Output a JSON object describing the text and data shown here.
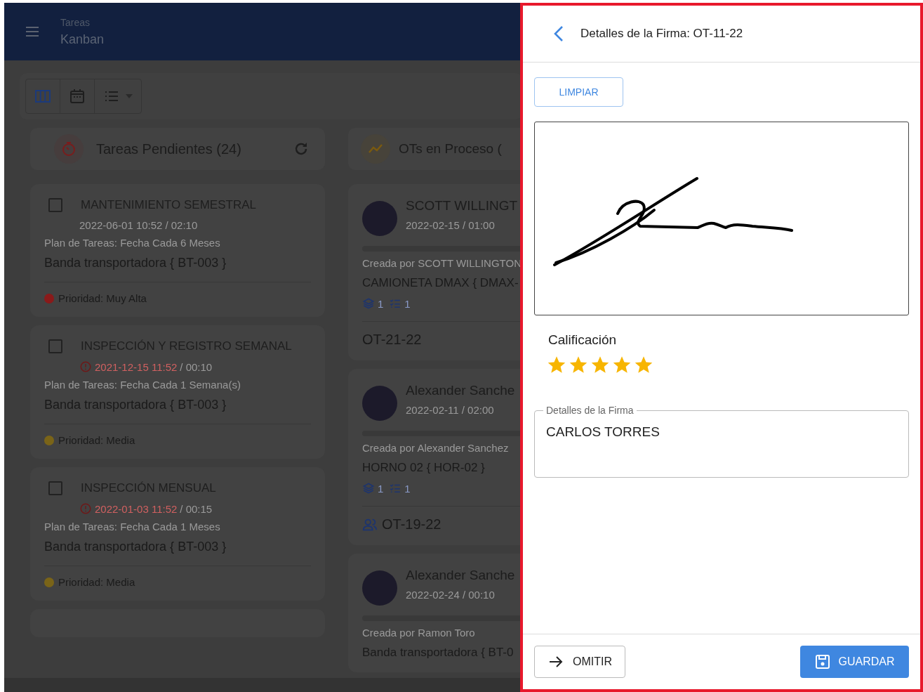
{
  "app_bar": {
    "section": "Tareas",
    "title": "Kanban"
  },
  "view_buttons": [
    {
      "kind": "columns",
      "selected": true
    },
    {
      "kind": "calendar",
      "selected": false
    },
    {
      "kind": "list",
      "selected": false
    }
  ],
  "columns": [
    {
      "kind": "tasks",
      "title": "Tareas Pendientes (24)",
      "cards": [
        {
          "title": "MANTENIMIENTO SEMESTRAL",
          "checked": false,
          "date": "2022-06-01 10:52",
          "overdue": false,
          "duration": "/ 02:10",
          "plan": "Plan de Tareas: Fecha Cada 6 Meses",
          "asset": "Banda transportadora { BT-003 }",
          "priority": "Prioridad: Muy Alta",
          "color": "#8a1a1a"
        },
        {
          "title": "INSPECCIÓN Y REGISTRO SEMANAL",
          "checked": false,
          "date": "2021-12-15 11:52",
          "overdue": true,
          "duration": "/ 00:10",
          "plan": "Plan de Tareas: Fecha Cada 1 Semana(s)",
          "asset": "Banda transportadora { BT-003 }",
          "priority": "Prioridad: Media",
          "color": "#7a6418"
        },
        {
          "title": "INSPECCIÓN MENSUAL",
          "checked": false,
          "date": "2022-01-03 11:52",
          "overdue": true,
          "duration": "/ 00:15",
          "plan": "Plan de Tareas: Fecha Cada 1 Meses",
          "asset": "Banda transportadora { BT-003 }",
          "priority": "Prioridad: Media",
          "color": "#7a6418"
        }
      ]
    },
    {
      "kind": "orders",
      "title": "OTs en Proceso (",
      "cards": [
        {
          "name": "SCOTT WILLINGT",
          "date": "2022-02-15 / 01:00",
          "creator": "Creada por SCOTT WILLINGTON",
          "asset": "CAMIONETA DMAX { DMAX-",
          "parts": "1",
          "tasks": "1",
          "code": "OT-21-22",
          "team": false
        },
        {
          "name": "Alexander Sanche",
          "date": "2022-02-11 / 02:00",
          "creator": "Creada por Alexander Sanchez",
          "asset": "HORNO 02 { HOR-02 }",
          "parts": "1",
          "tasks": "1",
          "code": "OT-19-22",
          "team": true
        },
        {
          "name": "Alexander Sanche",
          "date": "2022-02-24 / 00:10",
          "creator": "Creada por Ramon Toro",
          "asset": "Banda transportadora { BT-0"
        }
      ]
    }
  ],
  "panel": {
    "title": "Detalles de la Firma: OT-11-22",
    "clear_button": "LIMPIAR",
    "rating": {
      "label": "Calificación",
      "stars": 5
    },
    "details_field": {
      "label": "Detalles de la Firma",
      "value": "CARLOS TORRES"
    },
    "skip_button": "OMITIR",
    "save_button": "GUARDAR"
  }
}
